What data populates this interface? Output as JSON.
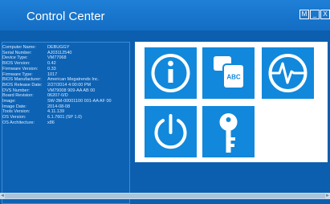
{
  "window": {
    "title": "Control Center",
    "buttons": {
      "settings": "M",
      "minimize": "_",
      "close": "X"
    }
  },
  "system_info": [
    {
      "label": "Computer Name:",
      "value": "DEBUGGY"
    },
    {
      "label": "Serial Number:",
      "value": "AJ03112540"
    },
    {
      "label": "Device Type:",
      "value": "VM77068"
    },
    {
      "label": "BIOS Version:",
      "value": "0.42"
    },
    {
      "label": "Firmware Version:",
      "value": "0.33"
    },
    {
      "label": "Firmware Type:",
      "value": "1017"
    },
    {
      "label": "BIOS Manufacturer:",
      "value": "American Megatrends Inc."
    },
    {
      "label": "BIOS Release Date:",
      "value": "2/27/2014 4:00:00 PM"
    },
    {
      "label": "DVS Number:",
      "value": "VM79008 909-AA AB 00"
    },
    {
      "label": "Board Revision:",
      "value": "06207-0/D"
    },
    {
      "label": "Image:",
      "value": "SW-3M-00001100 001-AA AF 00"
    },
    {
      "label": "Image Date:",
      "value": "2014-08-08"
    },
    {
      "label": "Tools Version:",
      "value": "4.11.139"
    },
    {
      "label": "OS Version:",
      "value": "6.1.7601 (SP 1.0)"
    },
    {
      "label": "OS Architecture:",
      "value": "x86"
    }
  ],
  "tiles": [
    {
      "name": "info-tile",
      "icon": "info-icon"
    },
    {
      "name": "language-tile",
      "icon": "abc-keyboard-icon",
      "text": "ABC"
    },
    {
      "name": "diagnostics-tile",
      "icon": "heartbeat-icon"
    },
    {
      "name": "power-tile",
      "icon": "power-icon"
    },
    {
      "name": "security-tile",
      "icon": "key-icon"
    }
  ],
  "colors": {
    "background": "#0b5fae",
    "titlebar": "#136dc4",
    "tile": "#1188dc",
    "panel": "#0d62b3"
  }
}
